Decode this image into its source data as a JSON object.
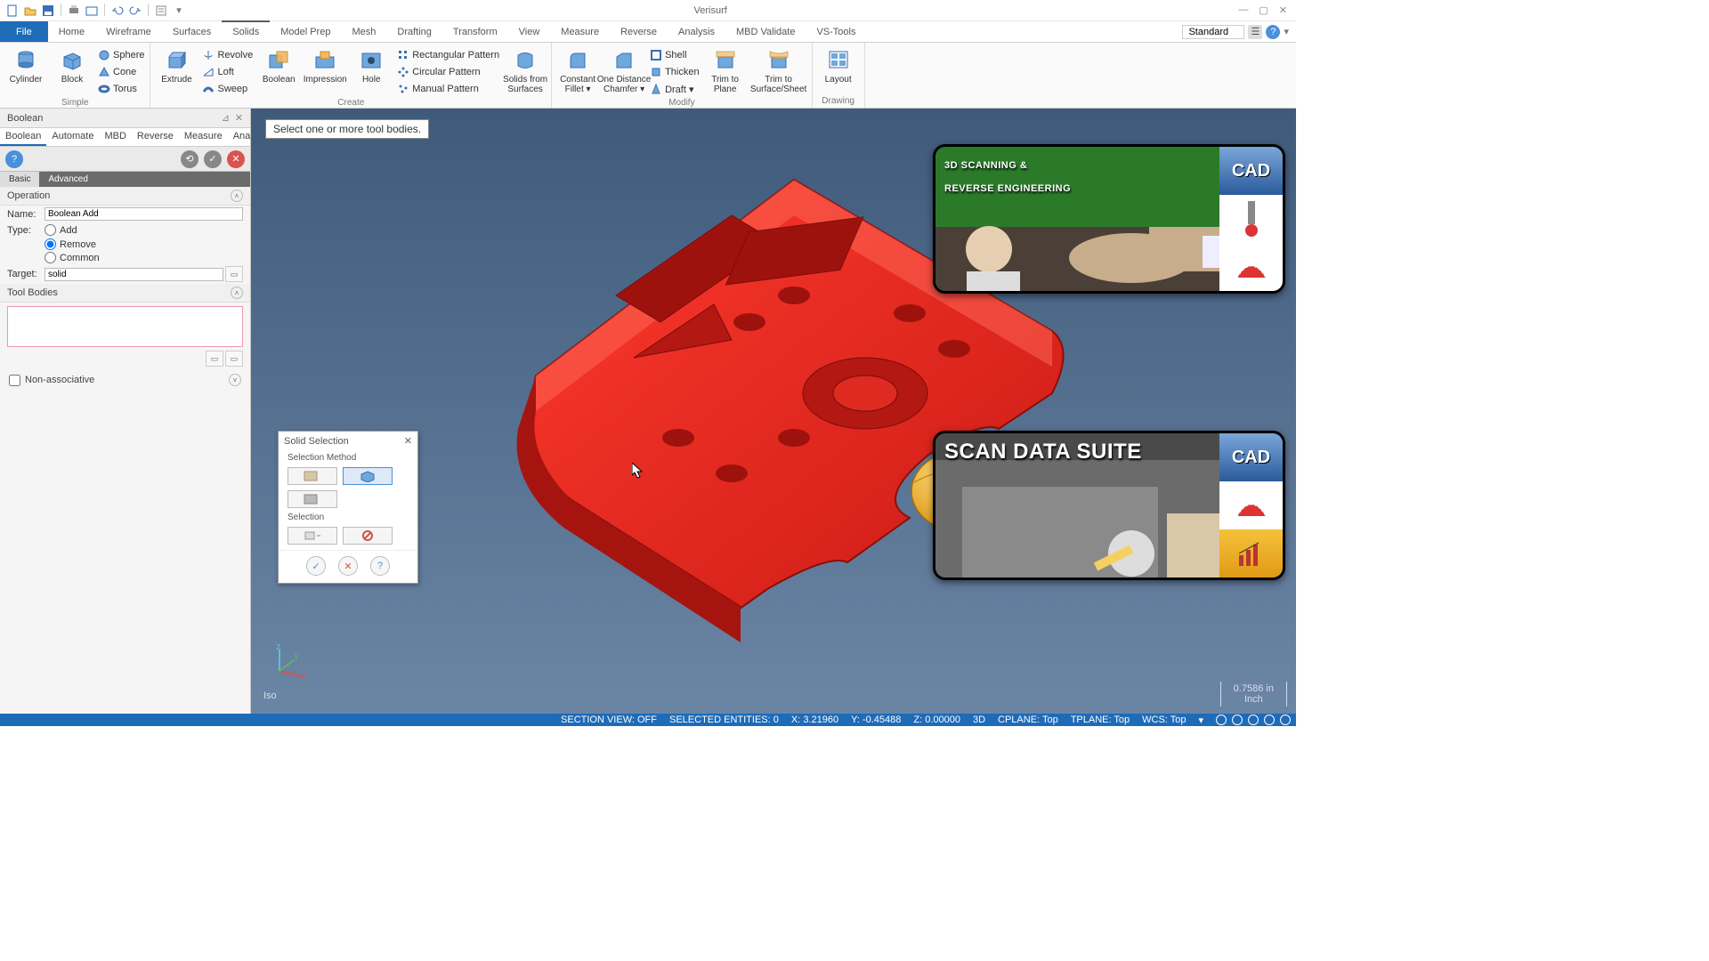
{
  "title": "Verisurf",
  "ribbon_tabs": [
    "File",
    "Home",
    "Wireframe",
    "Surfaces",
    "Solids",
    "Model Prep",
    "Mesh",
    "Drafting",
    "Transform",
    "View",
    "Measure",
    "Reverse",
    "Analysis",
    "MBD Validate",
    "VS-Tools"
  ],
  "active_ribbon_tab": "Solids",
  "combo_standard": "Standard",
  "ribbon": {
    "simple": {
      "label": "Simple",
      "big": [
        "Cylinder",
        "Block"
      ],
      "small": [
        "Sphere",
        "Cone",
        "Torus"
      ]
    },
    "create": {
      "label": "Create",
      "extrude": "Extrude",
      "rev": [
        "Revolve",
        "Loft",
        "Sweep"
      ],
      "boolean": "Boolean",
      "impression": "Impression",
      "hole": "Hole",
      "pattern": [
        "Rectangular Pattern",
        "Circular Pattern",
        "Manual Pattern"
      ],
      "sfs": "Solids from\nSurfaces"
    },
    "modify": {
      "label": "Modify",
      "cfillet": "Constant\nFillet ▾",
      "odc": "One Distance\nChamfer ▾",
      "small": [
        "Shell",
        "Thicken",
        "Draft ▾"
      ],
      "trimplane": "Trim to\nPlane",
      "trimsheet": "Trim to\nSurface/Sheet"
    },
    "drawing": {
      "label": "Drawing",
      "layout": "Layout"
    }
  },
  "panel": {
    "title": "Boolean",
    "tabs": [
      "Boolean",
      "Automate",
      "MBD",
      "Reverse",
      "Measure",
      "Analysis"
    ],
    "subtabs": {
      "basic": "Basic",
      "advanced": "Advanced"
    },
    "operation": {
      "heading": "Operation",
      "name_label": "Name:",
      "name_value": "Boolean Add",
      "type_label": "Type:",
      "types": [
        "Add",
        "Remove",
        "Common"
      ],
      "selected_type": "Remove",
      "target_label": "Target:",
      "target_value": "solid"
    },
    "tool_bodies": "Tool Bodies",
    "nonassoc": "Non-associative"
  },
  "viewport": {
    "hint": "Select one or more tool bodies.",
    "iso": "Iso",
    "scale_value": "0.7586 in",
    "scale_unit": "Inch"
  },
  "dialog": {
    "title": "Solid Selection",
    "sel_method": "Selection Method",
    "selection": "Selection"
  },
  "overlays": {
    "thumb1_line1": "3D SCANNING &",
    "thumb1_line2": "REVERSE ENGINEERING",
    "thumb2": "SCAN DATA SUITE",
    "cad": "CAD"
  },
  "status": {
    "section_view": "SECTION VIEW: OFF",
    "selected": "SELECTED ENTITIES: 0",
    "x": "X: 3.21960",
    "y": "Y: -0.45488",
    "z": "Z: 0.00000",
    "mode": "3D",
    "cplane": "CPLANE: Top",
    "tplane": "TPLANE: Top",
    "wcs": "WCS: Top"
  }
}
